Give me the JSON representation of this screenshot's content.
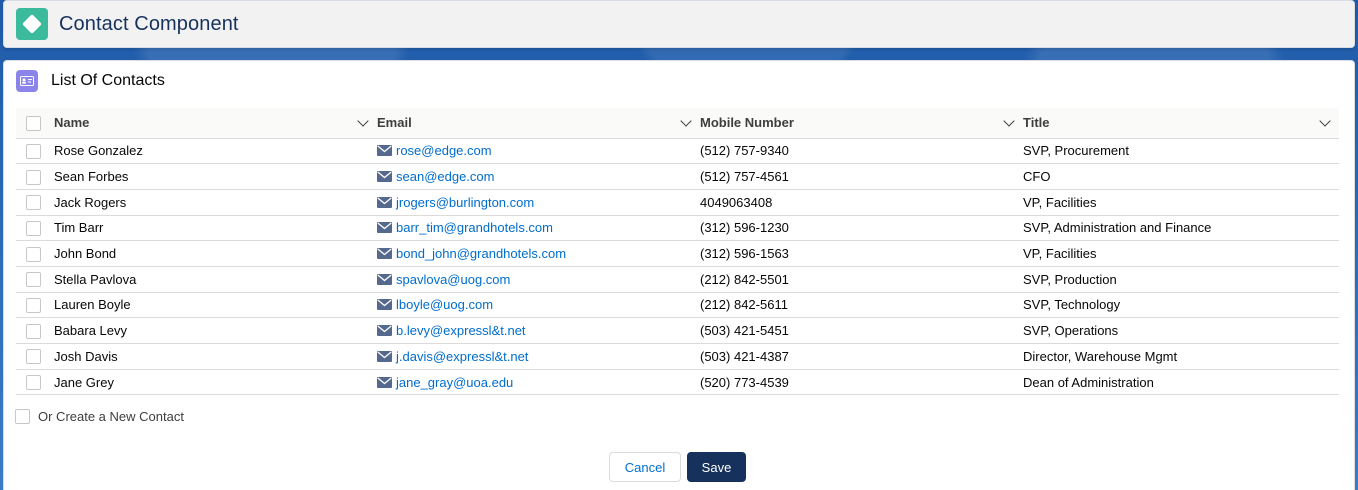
{
  "header": {
    "title": "Contact Component",
    "icon": "diamond-icon"
  },
  "card": {
    "title": "List Of Contacts",
    "icon": "contact-card-icon"
  },
  "table": {
    "columns": [
      "Name",
      "Email",
      "Mobile Number",
      "Title"
    ],
    "rows": [
      {
        "name": "Rose Gonzalez",
        "email": "rose@edge.com",
        "mobile": "(512) 757-9340",
        "title": "SVP, Procurement"
      },
      {
        "name": "Sean Forbes",
        "email": "sean@edge.com",
        "mobile": "(512) 757-4561",
        "title": "CFO"
      },
      {
        "name": "Jack Rogers",
        "email": "jrogers@burlington.com",
        "mobile": "4049063408",
        "title": "VP, Facilities"
      },
      {
        "name": "Tim Barr",
        "email": "barr_tim@grandhotels.com",
        "mobile": "(312) 596-1230",
        "title": "SVP, Administration and Finance"
      },
      {
        "name": "John Bond",
        "email": "bond_john@grandhotels.com",
        "mobile": "(312) 596-1563",
        "title": "VP, Facilities"
      },
      {
        "name": "Stella Pavlova",
        "email": "spavlova@uog.com",
        "mobile": "(212) 842-5501",
        "title": "SVP, Production"
      },
      {
        "name": "Lauren Boyle",
        "email": "lboyle@uog.com",
        "mobile": "(212) 842-5611",
        "title": "SVP, Technology"
      },
      {
        "name": "Babara Levy",
        "email": "b.levy@expressl&t.net",
        "mobile": "(503) 421-5451",
        "title": "SVP, Operations"
      },
      {
        "name": "Josh Davis",
        "email": "j.davis@expressl&t.net",
        "mobile": "(503) 421-4387",
        "title": "Director, Warehouse Mgmt"
      },
      {
        "name": "Jane Grey",
        "email": "jane_gray@uoa.edu",
        "mobile": "(520) 773-4539",
        "title": "Dean of Administration"
      }
    ]
  },
  "new_contact": {
    "label": "Or Create a New Contact",
    "checked": false
  },
  "buttons": {
    "cancel": "Cancel",
    "save": "Save"
  },
  "colors": {
    "accent": "#0070d2",
    "brand_button": "#16325c",
    "header_icon": "#3bba9c",
    "card_icon": "#8b84ea"
  }
}
